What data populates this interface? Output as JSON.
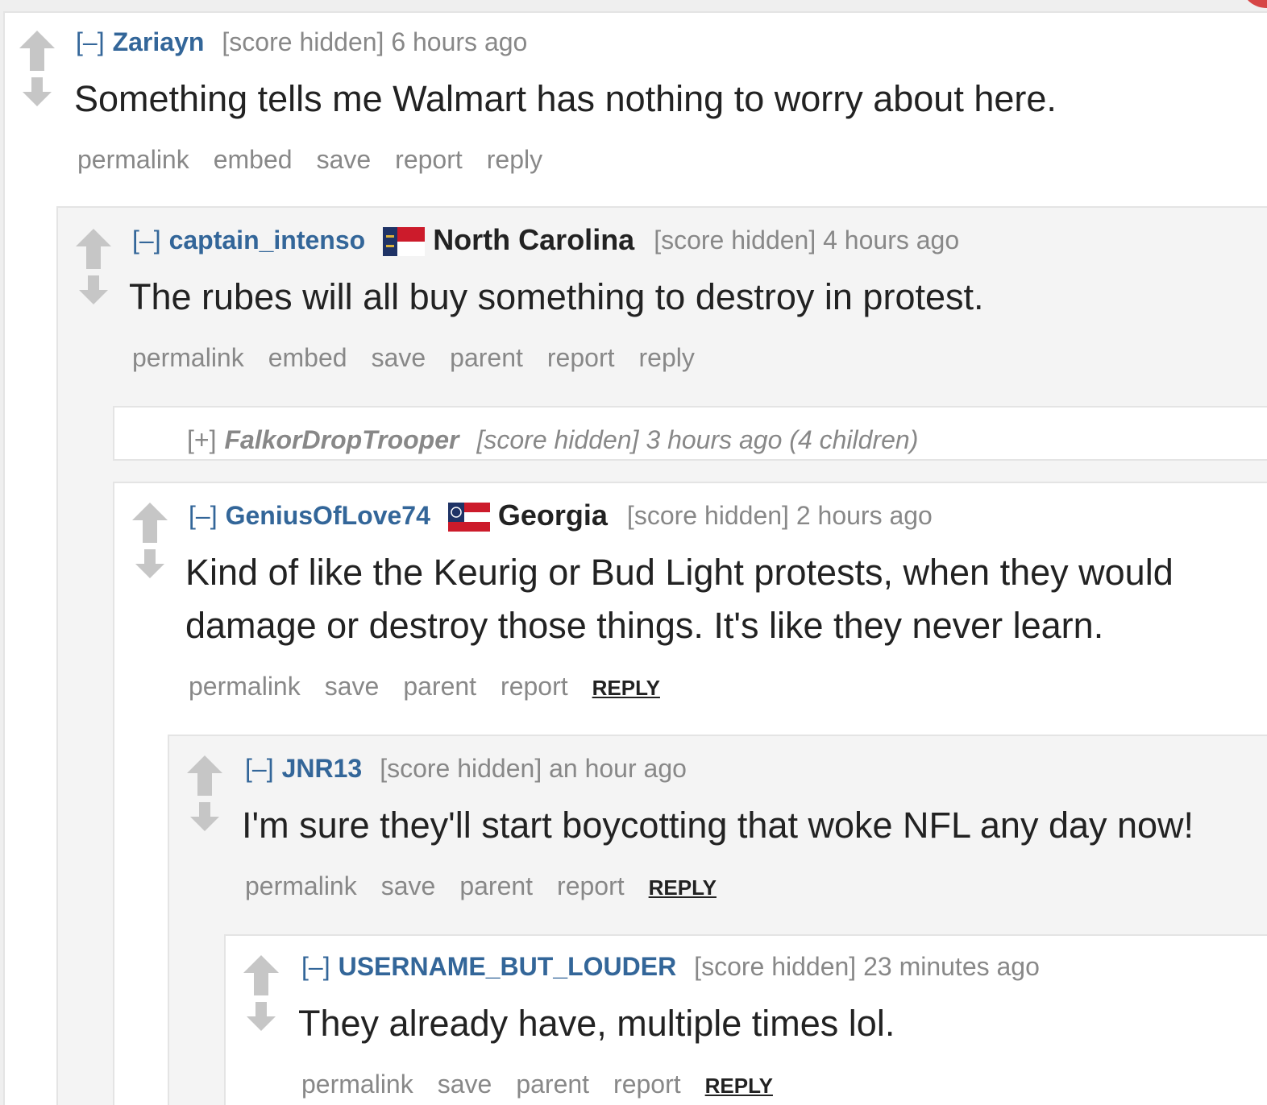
{
  "comments": [
    {
      "toggle": "[–]",
      "author": "Zariayn",
      "score": "[score hidden] 6 hours ago",
      "body": "Something tells me Walmart has nothing to worry about here.",
      "buttons": [
        "permalink",
        "embed",
        "save",
        "report",
        "reply"
      ]
    },
    {
      "toggle": "[–]",
      "author": "captain_intenso",
      "flair": "North Carolina",
      "flair_icon": "north-carolina-flag-icon",
      "score": "[score hidden] 4 hours ago",
      "body": "The rubes will all buy something to destroy in protest.",
      "buttons": [
        "permalink",
        "embed",
        "save",
        "parent",
        "report",
        "reply"
      ]
    },
    {
      "toggle": "[+]",
      "author": "FalkorDropTrooper",
      "score": "[score hidden] 3 hours ago (4 children)",
      "collapsed": true
    },
    {
      "toggle": "[–]",
      "author": "GeniusOfLove74",
      "flair": "Georgia",
      "flair_icon": "georgia-flag-icon",
      "score": "[score hidden] 2 hours ago",
      "body": "Kind of like the Keurig or Bud Light protests, when they would damage or destroy those things. It's like they never learn.",
      "buttons": [
        "permalink",
        "save",
        "parent",
        "report"
      ],
      "reply_label": "REPLY"
    },
    {
      "toggle": "[–]",
      "author": "JNR13",
      "score": "[score hidden] an hour ago",
      "body": "I'm sure they'll start boycotting that woke NFL any day now!",
      "buttons": [
        "permalink",
        "save",
        "parent",
        "report"
      ],
      "reply_label": "REPLY"
    },
    {
      "toggle": "[–]",
      "author": "USERNAME_BUT_LOUDER",
      "score": "[score hidden] 23 minutes ago",
      "body": "They already have, multiple times lol.",
      "buttons": [
        "permalink",
        "save",
        "parent",
        "report"
      ],
      "reply_label": "REPLY"
    }
  ],
  "colors": {
    "author": "#336699",
    "meta": "#888888",
    "body": "#222222",
    "panel_white": "#ffffff",
    "panel_grey": "#f4f4f4",
    "vote_arrow": "#c6c6c6"
  }
}
